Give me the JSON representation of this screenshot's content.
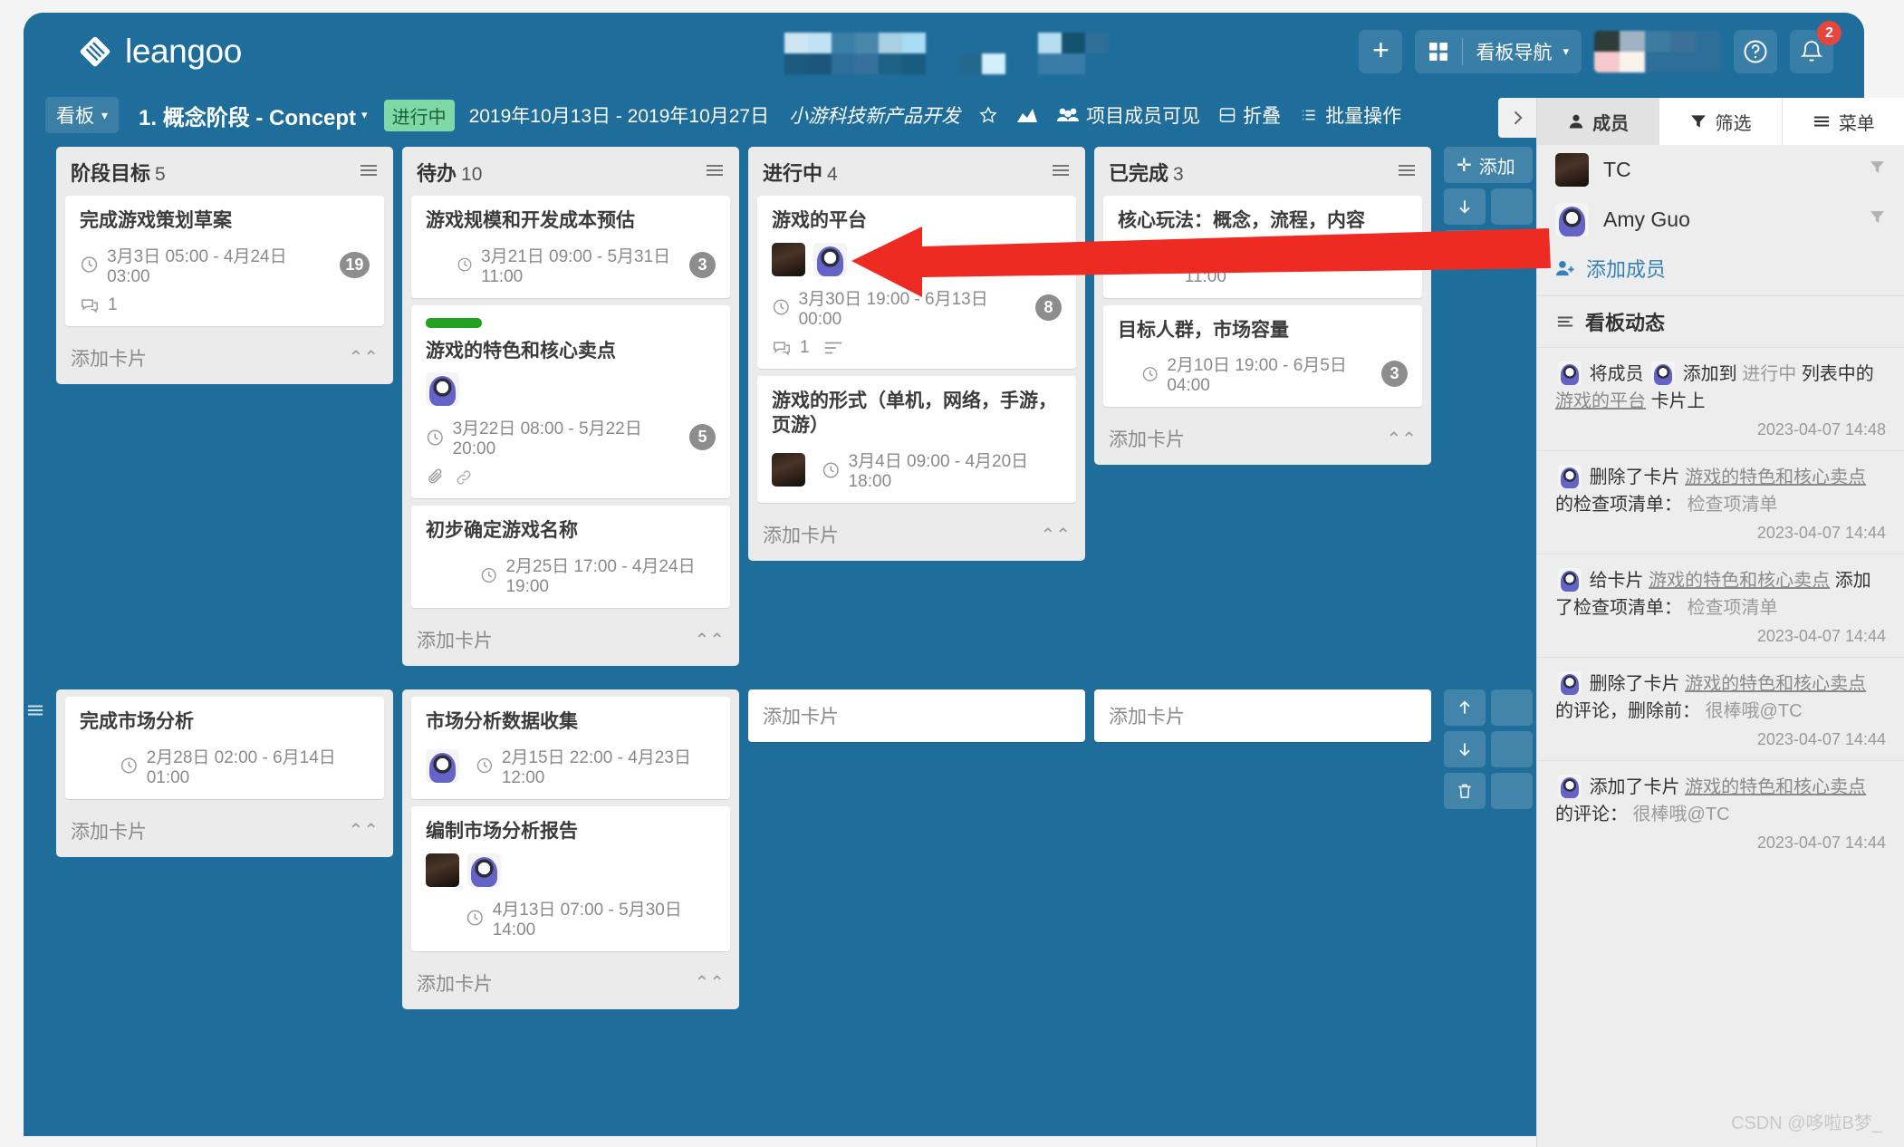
{
  "app": {
    "brand": "leangoo",
    "header": {
      "add_label": "+",
      "nav_label": "看板导航",
      "help_icon": "help-circle-icon",
      "bell_icon": "bell-icon",
      "notification_count": "2"
    }
  },
  "boardbar": {
    "board_menu": "看板",
    "title": "1. 概念阶段 - Concept",
    "status": "进行中",
    "dates": "2019年10月13日 - 2019年10月27日",
    "project": "小游科技新产品开发",
    "star_icon": "star-icon",
    "chart_icon": "chart-icon",
    "visibility": "项目成员可见",
    "collapse": "折叠",
    "batch": "批量操作"
  },
  "lanes": [
    {
      "lists": [
        {
          "title": "阶段目标",
          "count": "5",
          "add_card": "添加卡片",
          "cards": [
            {
              "title": "完成游戏策划草案",
              "date": "3月3日 05:00 - 4月24日 03:00",
              "badge": "19",
              "comments": "1",
              "avatars": []
            }
          ]
        },
        {
          "title": "待办",
          "count": "10",
          "add_card": "添加卡片",
          "cards": [
            {
              "title": "游戏规模和开发成本预估",
              "date": "3月21日 09:00 - 5月31日 11:00",
              "badge": "3",
              "avatars": [],
              "indent": true
            },
            {
              "title": "游戏的特色和核心卖点",
              "date": "3月22日 08:00 - 5月22日 20:00",
              "badge": "5",
              "tag_color": "#22a11f",
              "avatars": [
                "amy"
              ],
              "attachment": true,
              "link": true
            },
            {
              "title": "初步确定游戏名称",
              "date": "2月25日 17:00 - 4月24日 19:00",
              "avatars": [],
              "indent": true
            }
          ]
        },
        {
          "title": "进行中",
          "count": "4",
          "add_card": "添加卡片",
          "cards": [
            {
              "title": "游戏的平台",
              "date": "3月30日 19:00 - 6月13日 00:00",
              "badge": "8",
              "comments": "1",
              "avatars": [
                "tc",
                "amy"
              ],
              "has_description": true
            },
            {
              "title": "游戏的形式（单机，网络，手游，页游）",
              "date": "3月4日 09:00 - 4月20日 18:00",
              "avatars": [
                "tc"
              ],
              "inline_date": true
            }
          ]
        },
        {
          "title": "已完成",
          "count": "3",
          "add_card": "添加卡片",
          "cards": [
            {
              "title": "核心玩法：概念，流程，内容",
              "date": "2月24日 22:00 - 4月18日 11:00",
              "avatars": [],
              "indent": true
            },
            {
              "title": "目标人群，市场容量",
              "date": "2月10日 19:00 - 6月5日 04:00",
              "badge": "3",
              "avatars": [],
              "indent": true
            }
          ]
        }
      ],
      "actions": {
        "add": "添加",
        "down_icon": "arrow-down-icon",
        "trash_icon": "trash-icon"
      }
    },
    {
      "lists": [
        {
          "title": "",
          "count": "",
          "add_card": "添加卡片",
          "cards": [
            {
              "title": "完成市场分析",
              "date": "2月28日 02:00 - 6月14日 01:00",
              "avatars": [],
              "indent": true
            }
          ]
        },
        {
          "title": "",
          "count": "",
          "add_card": "添加卡片",
          "cards": [
            {
              "title": "市场分析数据收集",
              "date": "2月15日 22:00 - 4月23日 12:00",
              "avatars": [
                "amy"
              ],
              "inline_date": true
            },
            {
              "title": "编制市场分析报告",
              "date": "4月13日 07:00 - 5月30日 14:00",
              "avatars": [
                "tc",
                "amy"
              ],
              "indent": true
            }
          ]
        }
      ],
      "drop_placeholders": [
        "添加卡片",
        "添加卡片"
      ],
      "actions": {
        "up_icon": "arrow-up-icon",
        "down_icon": "arrow-down-icon",
        "trash_icon": "trash-icon"
      }
    }
  ],
  "sidepanel": {
    "toggle_icon": "chevron-right-icon",
    "tabs": [
      {
        "label": "成员",
        "icon": "user-icon",
        "active": true
      },
      {
        "label": "筛选",
        "icon": "filter-icon",
        "active": false
      },
      {
        "label": "菜单",
        "icon": "menu-icon",
        "active": false
      }
    ],
    "members": [
      {
        "name": "TC",
        "avatar": "tc"
      },
      {
        "name": "Amy Guo",
        "avatar": "amy"
      }
    ],
    "add_member": "添加成员",
    "activity_title": "看板动态",
    "activities": [
      {
        "parts": [
          {
            "t": "avatar",
            "v": "amy"
          },
          {
            "t": "text",
            "v": "将成员"
          },
          {
            "t": "avatar",
            "v": "amy"
          },
          {
            "t": "text",
            "v": "添加到"
          },
          {
            "t": "muted",
            "v": "进行中"
          },
          {
            "t": "text",
            "v": "列表中的"
          },
          {
            "t": "link",
            "v": "游戏的平台"
          },
          {
            "t": "text",
            "v": "卡片上"
          }
        ],
        "time": "2023-04-07 14:48"
      },
      {
        "parts": [
          {
            "t": "avatar",
            "v": "amy"
          },
          {
            "t": "text",
            "v": "删除了卡片"
          },
          {
            "t": "link",
            "v": "游戏的特色和核心卖点"
          },
          {
            "t": "text",
            "v": "的检查项清单："
          },
          {
            "t": "muted",
            "v": "检查项清单"
          }
        ],
        "time": "2023-04-07 14:44"
      },
      {
        "parts": [
          {
            "t": "avatar",
            "v": "amy"
          },
          {
            "t": "text",
            "v": "给卡片"
          },
          {
            "t": "link",
            "v": "游戏的特色和核心卖点"
          },
          {
            "t": "text",
            "v": "添加了检查项清单："
          },
          {
            "t": "muted",
            "v": "检查项清单"
          }
        ],
        "time": "2023-04-07 14:44"
      },
      {
        "parts": [
          {
            "t": "avatar",
            "v": "amy"
          },
          {
            "t": "text",
            "v": "删除了卡片"
          },
          {
            "t": "link",
            "v": "游戏的特色和核心卖点"
          },
          {
            "t": "text",
            "v": "的评论，删除前："
          },
          {
            "t": "muted",
            "v": "很棒哦@TC"
          }
        ],
        "time": "2023-04-07 14:44"
      },
      {
        "parts": [
          {
            "t": "avatar",
            "v": "amy"
          },
          {
            "t": "text",
            "v": "添加了卡片"
          },
          {
            "t": "link",
            "v": "游戏的特色和核心卖点"
          },
          {
            "t": "text",
            "v": "的评论："
          },
          {
            "t": "muted",
            "v": "很棒哦@TC"
          }
        ],
        "time": "2023-04-07 14:44"
      }
    ]
  },
  "annotation": {
    "arrow_color": "#ee2b22"
  },
  "watermark": "CSDN @哆啦B梦_"
}
